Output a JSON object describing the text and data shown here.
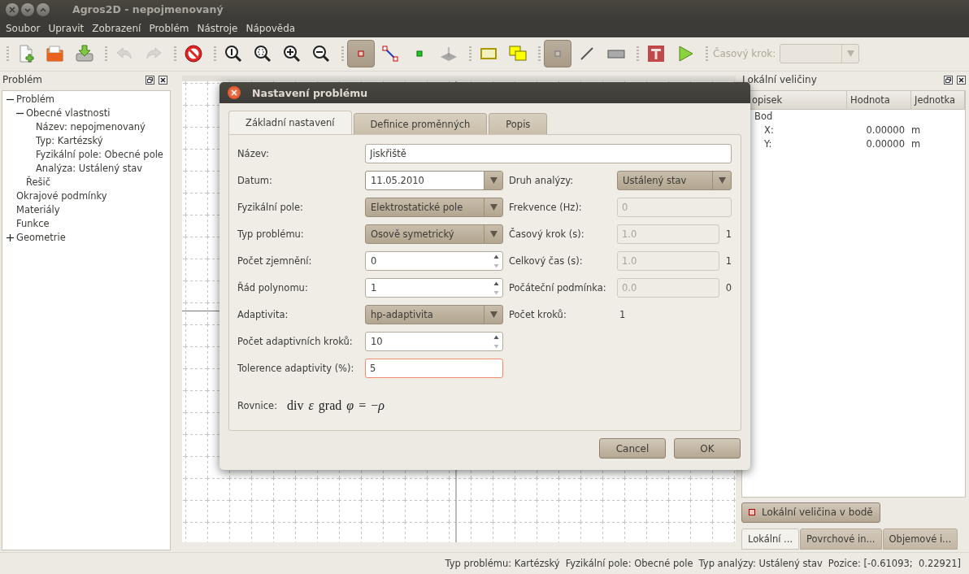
{
  "window": {
    "title": "Agros2D - nepojmenovaný"
  },
  "menu": [
    "Soubor",
    "Upravit",
    "Zobrazení",
    "Problém",
    "Nástroje",
    "Nápověda"
  ],
  "toolbar": {
    "groups": [
      [
        {
          "pressed": false,
          "disabled": false
        },
        {
          "pressed": false,
          "disabled": false
        },
        {
          "pressed": false,
          "disabled": false
        }
      ],
      [
        {
          "pressed": false,
          "disabled": true
        },
        {
          "pressed": false,
          "disabled": true
        }
      ],
      [
        {
          "pressed": false,
          "disabled": false
        }
      ],
      [
        {
          "pressed": false,
          "disabled": false
        },
        {
          "pressed": false,
          "disabled": false
        },
        {
          "pressed": false,
          "disabled": false
        },
        {
          "pressed": false,
          "disabled": false
        }
      ],
      [
        {
          "pressed": true,
          "disabled": false
        },
        {
          "pressed": false,
          "disabled": false
        },
        {
          "pressed": false,
          "disabled": false
        },
        {
          "pressed": false,
          "disabled": false
        }
      ],
      [
        {
          "pressed": false,
          "disabled": false
        },
        {
          "pressed": false,
          "disabled": false
        }
      ],
      [
        {
          "pressed": true,
          "disabled": false
        },
        {
          "pressed": false,
          "disabled": false
        },
        {
          "pressed": false,
          "disabled": false
        }
      ],
      [
        {
          "pressed": false,
          "disabled": false
        },
        {
          "pressed": false,
          "disabled": false
        }
      ]
    ],
    "time_step": {
      "label": "Časový krok:",
      "disabled": true
    }
  },
  "left_dock": {
    "title": "Problém",
    "tree": [
      {
        "label": "Problém",
        "expanded": true,
        "children": [
          {
            "label": "Obecné vlastnosti",
            "expanded": true,
            "children": [
              {
                "label": "Název: nepojmenovaný"
              },
              {
                "label": "Typ: Kartézský"
              },
              {
                "label": "Fyzikální pole: Obecné pole"
              },
              {
                "label": "Analýza: Ustálený stav"
              }
            ]
          },
          {
            "label": "Řešič"
          }
        ]
      },
      {
        "label": "Okrajové podmínky"
      },
      {
        "label": "Materiály"
      },
      {
        "label": "Funkce"
      },
      {
        "label": "Geometrie",
        "expanded": false
      }
    ]
  },
  "right_dock": {
    "title": "Lokální veličiny",
    "columns": [
      "opisek",
      "Hodnota",
      "Jednotka"
    ],
    "rows": [
      {
        "label": "Bod",
        "children": [
          {
            "label": "X:",
            "value": "0.00000",
            "unit": "m"
          },
          {
            "label": "Y:",
            "value": "0.00000",
            "unit": "m"
          }
        ]
      }
    ],
    "button": "Lokální veličina v bodě",
    "tabs": [
      {
        "label": "Lokální ...",
        "selected": true
      },
      {
        "label": "Povrchové in...",
        "selected": false
      },
      {
        "label": "Objemové i...",
        "selected": false
      }
    ]
  },
  "dialog": {
    "title": "Nastavení problému",
    "tabs": [
      {
        "label": "Základní nastavení",
        "selected": true
      },
      {
        "label": "Definice proměnných",
        "selected": false
      },
      {
        "label": "Popis",
        "selected": false
      }
    ],
    "name_field": {
      "label": "Název:",
      "value": "Jiskřiště"
    },
    "rows": [
      {
        "left": {
          "label": "Datum:",
          "kind": "date",
          "value": "11.05.2010"
        },
        "right": {
          "label": "Druh analýzy:",
          "kind": "combo",
          "value": "Ustálený stav"
        }
      },
      {
        "left": {
          "label": "Fyzikální pole:",
          "kind": "combo",
          "value": "Elektrostatické pole"
        },
        "right": {
          "label": "Frekvence (Hz):",
          "kind": "text",
          "value": "0",
          "disabled": true,
          "focused": false
        }
      },
      {
        "left": {
          "label": "Typ problému:",
          "kind": "combo",
          "value": "Osově symetrický"
        },
        "right": {
          "label": "Časový krok (s):",
          "kind": "text",
          "value": "1.0",
          "disabled": true,
          "focused": false,
          "suffix": "1"
        }
      },
      {
        "left": {
          "label": "Počet zjemnění:",
          "kind": "spin",
          "value": "0"
        },
        "right": {
          "label": "Celkový čas (s):",
          "kind": "text",
          "value": "1.0",
          "disabled": true,
          "focused": false,
          "suffix": "1"
        }
      },
      {
        "left": {
          "label": "Řád polynomu:",
          "kind": "spin",
          "value": "1"
        },
        "right": {
          "label": "Počáteční podmínka:",
          "kind": "text",
          "value": "0.0",
          "disabled": true,
          "focused": false,
          "suffix": "0"
        }
      },
      {
        "left": {
          "label": "Adaptivita:",
          "kind": "combo",
          "value": "hp-adaptivita"
        },
        "right": {
          "label": "Počet kroků:",
          "kind": "readout",
          "value": "1"
        }
      },
      {
        "left": {
          "label": "Počet adaptivních kroků:",
          "kind": "spin",
          "value": "10"
        }
      },
      {
        "left": {
          "label": "Tolerence adaptivity (%):",
          "kind": "text",
          "value": "5",
          "disabled": false,
          "focused": true
        }
      }
    ],
    "equation": {
      "label": "Rovnice:",
      "formula": "div *ε* grad *φ* = −*ρ*"
    },
    "buttons": [
      "Cancel",
      "OK"
    ]
  },
  "status_bar": [
    "Typ problému: Kartézský",
    "Fyzikální pole: Obecné pole",
    "Typ analýzy: Ustálený stav",
    "Pozice: [-0.61093;  0.22921]"
  ]
}
